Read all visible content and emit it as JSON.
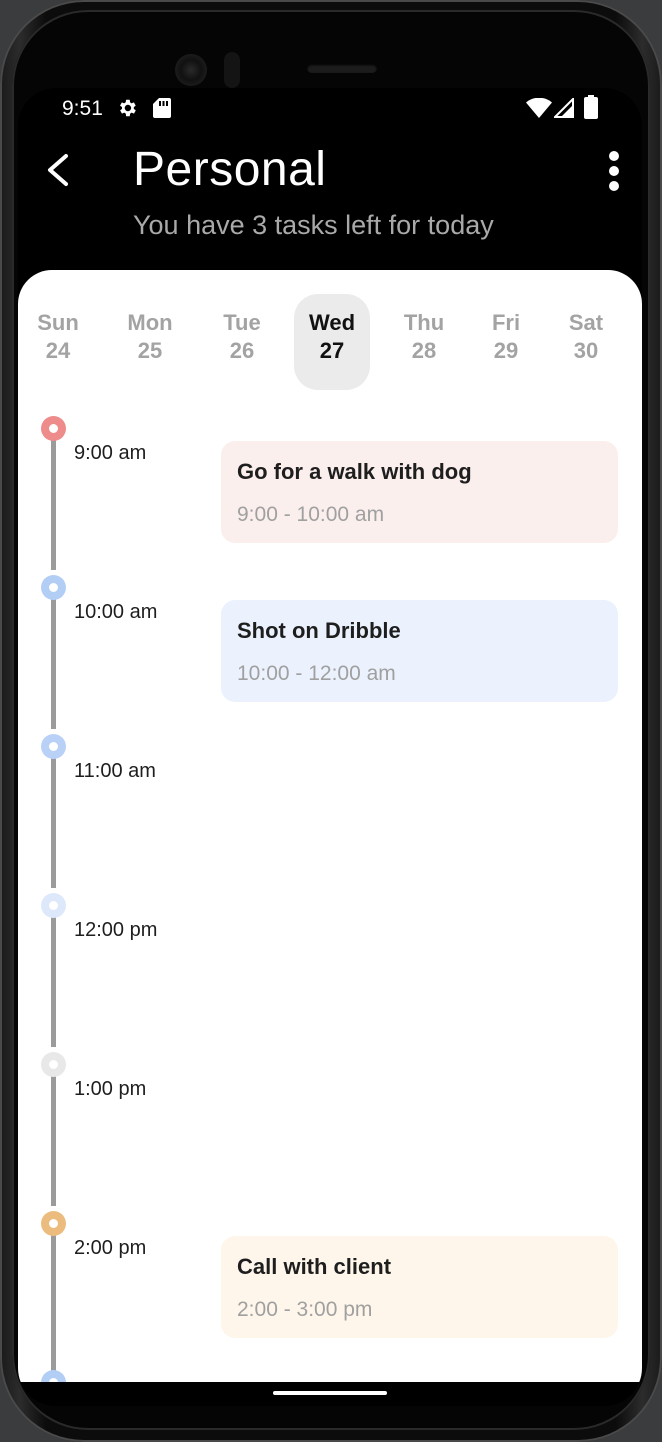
{
  "status_bar": {
    "time": "9:51",
    "icons": [
      "gear-icon",
      "sd-card-icon",
      "wifi-icon",
      "signal-icon",
      "battery-icon"
    ]
  },
  "header": {
    "back_icon": "chevron-left-icon",
    "title": "Personal",
    "subtitle": "You have 3 tasks left for today",
    "menu_icon": "more-vertical-icon"
  },
  "week": {
    "days": [
      {
        "name": "Sun",
        "date": "24"
      },
      {
        "name": "Mon",
        "date": "25"
      },
      {
        "name": "Tue",
        "date": "26"
      },
      {
        "name": "Wed",
        "date": "27"
      },
      {
        "name": "Thu",
        "date": "28"
      },
      {
        "name": "Fri",
        "date": "29"
      },
      {
        "name": "Sat",
        "date": "30"
      }
    ],
    "selected": "Wed"
  },
  "timeline": {
    "slots": [
      {
        "time": "9:00 am",
        "dot_color": "#ee8b8b"
      },
      {
        "time": "10:00 am",
        "dot_color": "#b3cef5"
      },
      {
        "time": "11:00 am",
        "dot_color": "#b9d1f6"
      },
      {
        "time": "12:00 pm",
        "dot_color": "#dde9fb"
      },
      {
        "time": "1:00 pm",
        "dot_color": "#e8e8e8"
      },
      {
        "time": "2:00 pm",
        "dot_color": "#ecbc7f"
      }
    ]
  },
  "tasks": [
    {
      "title": "Go for a walk with dog",
      "time": "9:00 - 10:00 am",
      "color": "#fbefee"
    },
    {
      "title": "Shot on Dribble",
      "time": "10:00 - 12:00 am",
      "color": "#ebf2fd"
    },
    {
      "title": "Call with client",
      "time": "2:00 - 3:00 pm",
      "color": "#fef6ea"
    }
  ],
  "colors": {
    "background": "#000000",
    "card": "#ffffff",
    "timeline_line": "#9b9b9b",
    "selected_day": "#ebebeb"
  }
}
